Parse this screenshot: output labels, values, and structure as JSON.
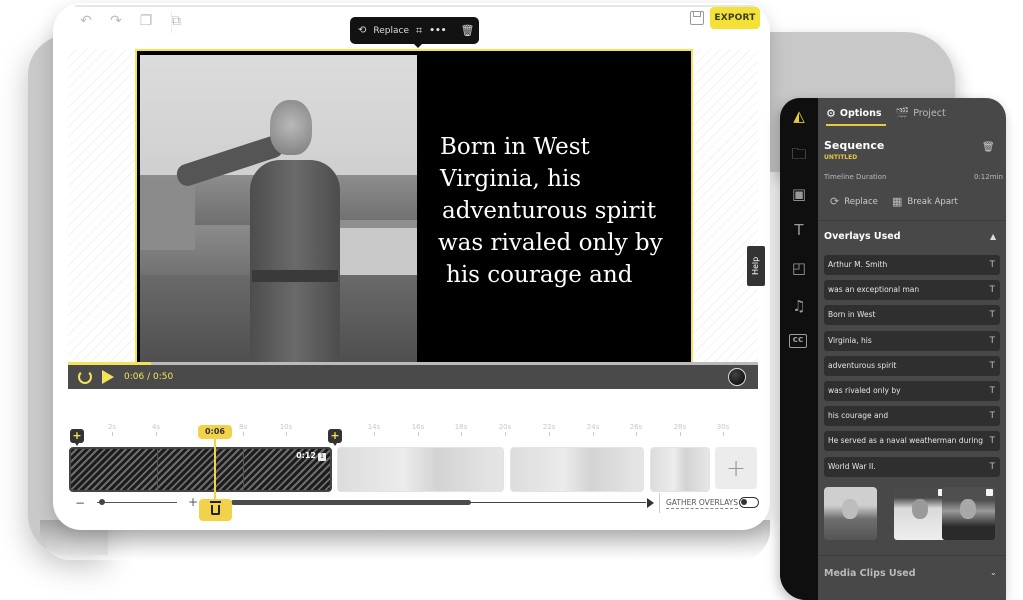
{
  "toolbar": {
    "undo_icon": "undo-icon",
    "redo_icon": "redo-icon",
    "bring_forward_icon": "layer-forward-icon",
    "group_icon": "group-icon",
    "save_icon": "save-icon",
    "export_label": "EXPORT"
  },
  "floating_toolbar": {
    "replace_label": "Replace",
    "crop_icon": "crop-icon",
    "more_icon": "more-icon",
    "delete_icon": "trash-icon"
  },
  "canvas": {
    "overlay_lines": [
      "Born in West",
      "Virginia, his",
      "adventurous spirit",
      "was rivaled only by",
      "his courage and"
    ]
  },
  "player": {
    "current_time": "0:06",
    "total_time": "0:50",
    "time_display": "0:06  /  0:50",
    "progress_fraction": 0.12
  },
  "help_label": "Help",
  "timeline": {
    "playhead_label": "0:06",
    "ticks": [
      "2s",
      "4s",
      "8s",
      "10s",
      "14s",
      "16s",
      "18s",
      "20s",
      "22s",
      "24s",
      "26s",
      "28s",
      "30s"
    ],
    "active_clip_duration": "0:12",
    "active_clip_badge": "1",
    "add_clip_label": "+",
    "add_marker_label": "+",
    "zoom_minus": "−",
    "zoom_plus": "+",
    "zoom_level": 0.05,
    "scroll_fraction": 0.58,
    "gather_overlays_label": "GATHER OVERLAYS",
    "gather_overlays_on": false
  },
  "panel": {
    "rail_icons": [
      "storyboard-icon",
      "upload-folder-icon",
      "media-icon",
      "text-icon",
      "shapes-icon",
      "music-icon",
      "captions-icon"
    ],
    "tabs": [
      {
        "label": "Options",
        "active": true
      },
      {
        "label": "Project",
        "active": false
      }
    ],
    "sequence_title": "Sequence",
    "sequence_subtitle": "UNTITLED",
    "timeline_duration_label": "Timeline Duration",
    "timeline_duration_value": "0:12min",
    "replace_label": "Replace",
    "break_apart_label": "Break Apart",
    "overlays_title": "Overlays Used",
    "overlays": [
      "Arthur M. Smith",
      "was an exceptional man",
      "Born in West",
      "Virginia, his",
      "adventurous spirit",
      "was rivaled only by",
      "his courage and",
      "He served as a naval weatherman during",
      "World War II."
    ],
    "media_clips_title": "Media Clips Used"
  },
  "colors": {
    "accent": "#f2e35a",
    "panel_bg": "#484848",
    "rail_bg": "#0f0f0f"
  }
}
